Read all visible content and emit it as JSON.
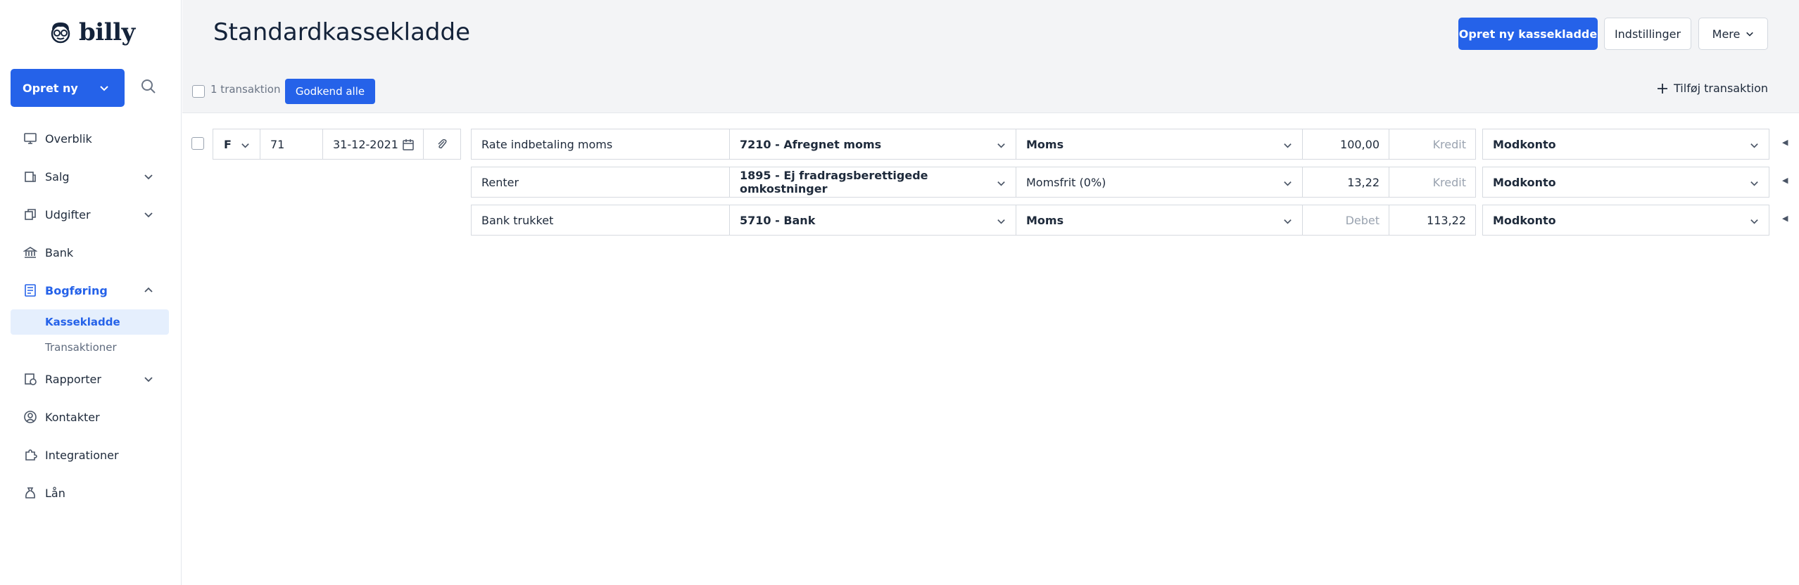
{
  "brand": {
    "name": "billy"
  },
  "sidebar": {
    "create_label": "Opret ny",
    "items": [
      {
        "label": "Overblik",
        "icon": "monitor-icon",
        "expandable": false
      },
      {
        "label": "Salg",
        "icon": "receipt-icon",
        "expandable": true
      },
      {
        "label": "Udgifter",
        "icon": "documents-icon",
        "expandable": true
      },
      {
        "label": "Bank",
        "icon": "bank-icon",
        "expandable": false
      },
      {
        "label": "Bogføring",
        "icon": "ledger-icon",
        "expandable": true,
        "active": true
      },
      {
        "label": "Rapporter",
        "icon": "report-icon",
        "expandable": true
      },
      {
        "label": "Kontakter",
        "icon": "contacts-icon",
        "expandable": false
      },
      {
        "label": "Integrationer",
        "icon": "puzzle-icon",
        "expandable": false
      },
      {
        "label": "Lån",
        "icon": "money-bag-icon",
        "expandable": false
      }
    ],
    "subitems": [
      {
        "label": "Kassekladde",
        "active": true
      },
      {
        "label": "Transaktioner",
        "active": false
      }
    ]
  },
  "header": {
    "title": "Standardkassekladde",
    "new_journal_label": "Opret ny kassekladde",
    "settings_label": "Indstillinger",
    "more_label": "Mere"
  },
  "toolbar": {
    "count_label": "1 transaktion",
    "approve_label": "Godkend alle",
    "add_label": "Tilføj transaktion"
  },
  "transaction": {
    "type": "F",
    "number": "71",
    "date": "31-12-2021",
    "lines": [
      {
        "description": "Rate indbetaling moms",
        "account": "7210 - Afregnet moms",
        "vat": "Moms",
        "debit": "100,00",
        "credit": "Kredit",
        "counter": "Modkonto"
      },
      {
        "description": "Renter",
        "account": "1895 - Ej fradragsberettigede omkostninger",
        "vat": "Momsfrit (0%)",
        "debit": "13,22",
        "credit": "Kredit",
        "counter": "Modkonto"
      },
      {
        "description": "Bank trukket",
        "account": "5710 - Bank",
        "vat": "Moms",
        "debit": "Debet",
        "credit": "113,22",
        "counter": "Modkonto"
      }
    ]
  },
  "colors": {
    "accent": "#2562e9",
    "header_bg": "#f3f4f6",
    "active_bg": "#e5effd",
    "placeholder": "#9aa3b0"
  }
}
